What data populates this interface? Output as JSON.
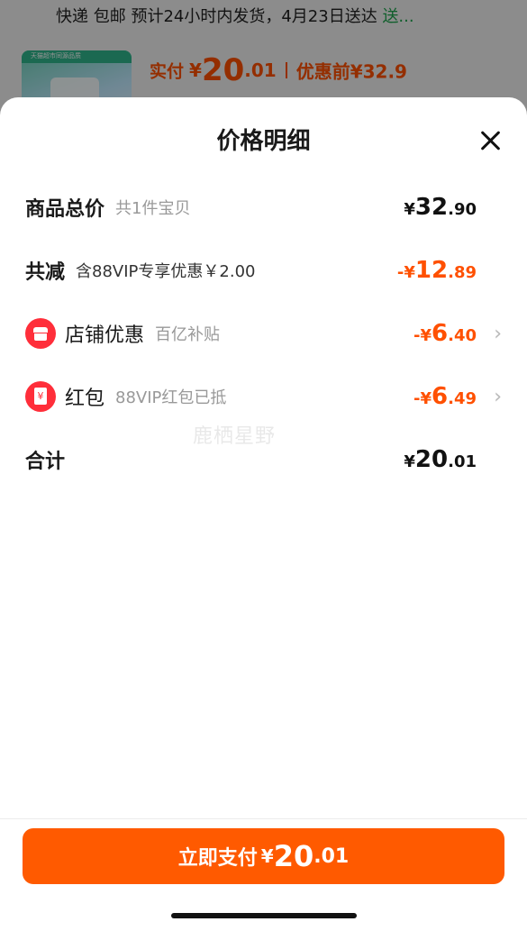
{
  "background": {
    "shipping_prefix": "快递 包邮 预计24小时内发货，4月23日送达 ",
    "shipping_link": "送...",
    "thumb_tag": "天猫超市同源品质",
    "price_label": "实付",
    "price_yen": "¥",
    "price_int": "20",
    "price_dec": ".01",
    "original_price": "优惠前¥32.9"
  },
  "sheet": {
    "title": "价格明细",
    "close_icon": "close-icon"
  },
  "rows": {
    "total": {
      "label": "商品总价",
      "sub": "共1件宝贝",
      "yen": "¥",
      "int": "32",
      "dec": ".90"
    },
    "discount": {
      "label": "共减",
      "sub": "含88VIP专享优惠￥2.00",
      "yen": "-¥",
      "int": "12",
      "dec": ".89"
    },
    "shop": {
      "label": "店铺优惠",
      "sub": "百亿补贴",
      "yen": "-¥",
      "int": "6",
      "dec": ".40",
      "icon": "shop-icon"
    },
    "redpacket": {
      "label": "红包",
      "sub": "88VIP红包已抵",
      "yen": "-¥",
      "int": "6",
      "dec": ".49",
      "icon": "red-packet-icon"
    },
    "sum": {
      "label": "合计",
      "yen": "¥",
      "int": "20",
      "dec": ".01"
    }
  },
  "watermark": "鹿栖星野",
  "pay_button": {
    "label": "立即支付",
    "yen": "¥",
    "int": "20",
    "dec": ".01"
  },
  "colors": {
    "accent": "#ff5000",
    "button": "#ff5a00",
    "icon_red": "#ff2e3a"
  }
}
